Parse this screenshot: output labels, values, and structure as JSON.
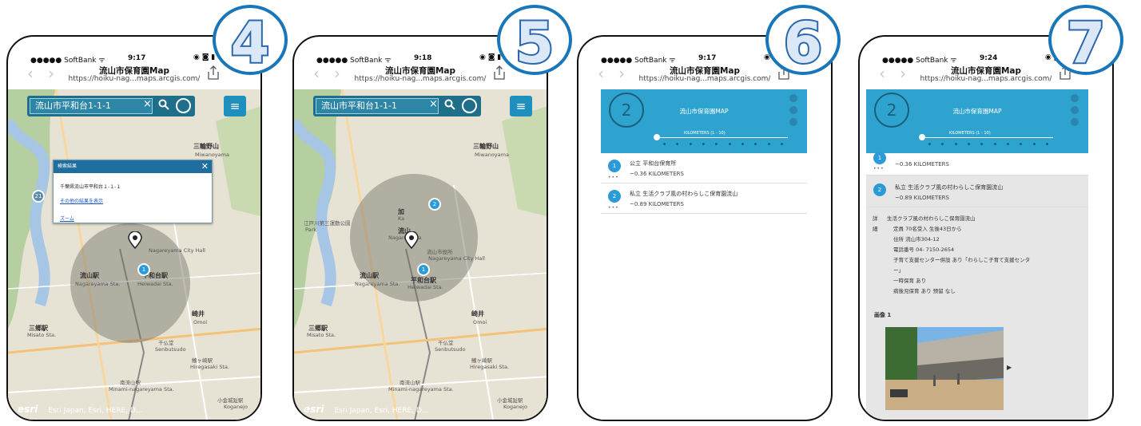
{
  "phone_screens": [
    {
      "badge": "4",
      "status": {
        "carrier": "●●●●● SoftBank ᯤ",
        "time": "9:17",
        "icons": "◉ ◙ ▮"
      },
      "browser": {
        "title": "流山市保育園Map",
        "url": "https://hoiku-nag...maps.arcgis.com/"
      },
      "search": {
        "value": "流山市平和台1-1-1",
        "clear": "×"
      },
      "map_labels": [
        "三輪野山",
        "Miwanoyama",
        "流山駅",
        "Nagareyama Sta.",
        "平和台駅",
        "Heiwadai Sta.",
        "崎井",
        "Omoi",
        "三郷駅",
        "Misato Sta.",
        "千仏堂",
        "Senbutsudo",
        "鰭ヶ崎駅",
        "Hiregasaki Sta.",
        "南流山駅",
        "Minami-nagareyama Sta.",
        "小金城趾駅",
        "Koganejo",
        "Nagareyama City Hall",
        "21"
      ],
      "marker": "1",
      "popup": {
        "header": "検索結果",
        "address": "千葉県流山市平和台１-１-１",
        "more_link": "その他の結果を表示",
        "zoom_link": "ズーム"
      },
      "attribution": {
        "logo": "esri",
        "text": "Esri Japan, Esri, HERE, D..."
      }
    },
    {
      "badge": "5",
      "status": {
        "carrier": "●●●●● SoftBank ᯤ",
        "time": "9:18",
        "icons": "◉ ◙ ▮"
      },
      "browser": {
        "title": "流山市保育園Map",
        "url": "https://hoiku-nag...maps.arcgis.com/"
      },
      "search": {
        "value": "流山市平和台1-1-1",
        "clear": "×"
      },
      "map_labels": [
        "三輪野山",
        "Miwanoyama",
        "加",
        "Ka",
        "流山",
        "Nagareyama",
        "流山市役所",
        "Nagareyama City Hall",
        "流山駅",
        "Nagareyama Sta.",
        "平和台駅",
        "Heiwadai Sta.",
        "江戸川第三運動公園",
        "Park",
        "崎井",
        "Omoi",
        "三郷駅",
        "Misato Sta.",
        "千仏堂",
        "Senbutsudo",
        "鰭ヶ崎駅",
        "Hiregasaki Sta.",
        "南流山駅",
        "Minami-nagareyama Sta.",
        "小金城趾駅",
        "Koganejo"
      ],
      "markers": [
        "2",
        "1"
      ],
      "attribution": {
        "logo": "esri",
        "text": "Esri Japan, Esri, HERE, D..."
      }
    },
    {
      "badge": "6",
      "status": {
        "carrier": "●●●●● SoftBank ᯤ",
        "time": "9:17",
        "icons": "◉ ◙ ▮"
      },
      "browser": {
        "title": "流山市保育園Map",
        "url": "https://hoiku-nag...maps.arcgis.com/"
      },
      "panel": {
        "count": "2",
        "title": "流山市保育園MAP",
        "slider_label": "KILOMETERS (1 - 10)"
      },
      "results": [
        {
          "num": "1",
          "name": "公立 平和台保育所",
          "distance": "~0.36 KILOMETERS",
          "more": "•••"
        },
        {
          "num": "2",
          "name": "私立 生活クラブ風の村わらしこ保育園流山",
          "distance": "~0.89 KILOMETERS",
          "more": "•••"
        }
      ]
    },
    {
      "badge": "7",
      "status": {
        "carrier": "●●●●● SoftBank ᯤ",
        "time": "9:24",
        "icons": "◉ ◙ ▮"
      },
      "browser": {
        "title": "流山市保育園Map",
        "url": "https://hoiku-nag...maps.arcgis.com/"
      },
      "panel": {
        "count": "2",
        "title": "流山市保育園MAP",
        "slider_label": "KILOMETERS (1 - 10)"
      },
      "results": [
        {
          "num": "1",
          "name": "公立 平和台保育所",
          "distance": "~0.36 KILOMETERS",
          "more": "•••"
        },
        {
          "num": "2",
          "name": "私立 生活クラブ風の村わらしこ保育園流山",
          "distance": "~0.89 KILOMETERS",
          "more": ""
        }
      ],
      "detail": {
        "side_label_1": "詳",
        "side_label_2": "細",
        "lines": [
          "生活クラブ風の村わらしこ保育園流山",
          "定員 70名受入 生後43日から",
          "住所 流山市304-12",
          "電話番号 04- 7150-2654",
          "子育て支援センター併設 あり「わらしこ子育て支援センタ",
          "ー」",
          "一時保育 あり",
          "病後児保育 あり 预留 なし"
        ],
        "image_label": "画像 1"
      }
    }
  ]
}
